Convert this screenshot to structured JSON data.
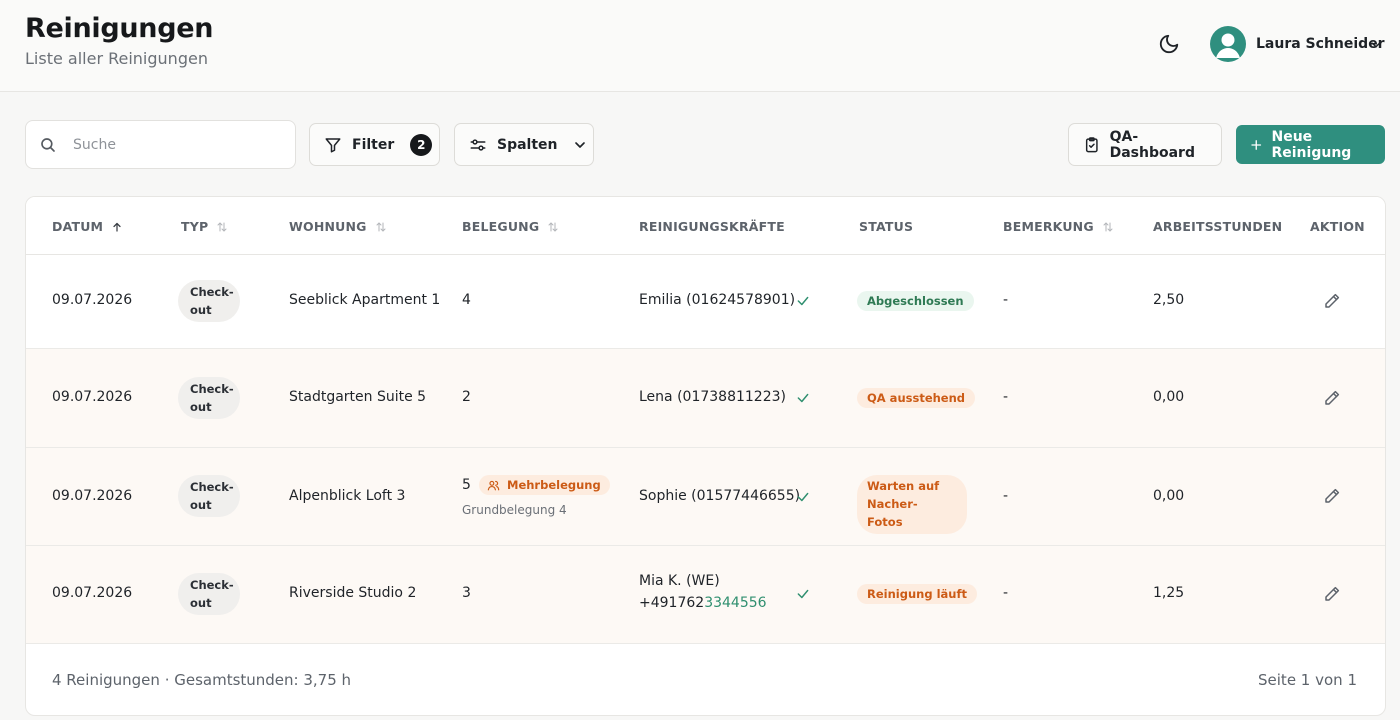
{
  "header": {
    "title": "Reinigungen",
    "subtitle": "Liste aller Reinigungen",
    "user_name": "Laura Schneider"
  },
  "toolbar": {
    "search_placeholder": "Suche",
    "filter_label": "Filter",
    "filter_count": "2",
    "columns_label": "Spalten",
    "qa_label": "QA-Dashboard",
    "new_label": "Neue Reinigung"
  },
  "table": {
    "columns": {
      "datum": "DATUM",
      "typ": "TYP",
      "wohnung": "WOHNUNG",
      "belegung": "BELEGUNG",
      "kraefte": "REINIGUNGSKRÄFTE",
      "status": "STATUS",
      "bemerkung": "BEMERKUNG",
      "stunden": "ARBEITSSTUNDEN",
      "aktion": "AKTION"
    },
    "rows": [
      {
        "date": "09.07.2026",
        "type_line1": "Check-",
        "type_line2": "out",
        "apartment": "Seeblick Apartment 1",
        "occupancy": "4",
        "cleaner": "Emilia (01624578901)",
        "status": "Abgeschlossen",
        "remark": "-",
        "hours": "2,50"
      },
      {
        "date": "09.07.2026",
        "type_line1": "Check-",
        "type_line2": "out",
        "apartment": "Stadtgarten Suite 5",
        "occupancy": "2",
        "cleaner": "Lena (01738811223)",
        "status": "QA ausstehend",
        "remark": "-",
        "hours": "0,00"
      },
      {
        "date": "09.07.2026",
        "type_line1": "Check-",
        "type_line2": "out",
        "apartment": "Alpenblick Loft 3",
        "occupancy": "5",
        "occupancy_badge": "Mehrbelegung",
        "occupancy_note": "Grundbelegung 4",
        "cleaner": "Sophie (01577446655)",
        "status_line1": "Warten auf",
        "status_line2": "Nacher-Fotos",
        "remark": "-",
        "hours": "0,00"
      },
      {
        "date": "09.07.2026",
        "type_line1": "Check-",
        "type_line2": "out",
        "apartment": "Riverside Studio 2",
        "occupancy": "3",
        "cleaner_line1": "Mia K. (WE)",
        "cleaner_phone_a": "+491762",
        "cleaner_phone_b": "3344556",
        "status": "Reinigung läuft",
        "remark": "-",
        "hours": "1,25"
      }
    ]
  },
  "footer": {
    "summary": "4 Reinigungen · Gesamtstunden: 3,75 h",
    "pagination": "Seite 1 von 1"
  },
  "colors": {
    "accent": "#2f8f7f",
    "status_done_bg": "#eaf6ef",
    "status_warn_bg": "#fdecdf",
    "status_warn_text": "#cc5b16"
  },
  "icons": [
    "moon-icon",
    "user-avatar-icon",
    "chevron-down-icon",
    "search-icon",
    "filter-icon",
    "sliders-icon",
    "clipboard-icon",
    "plus-icon",
    "sort-icon",
    "check-icon",
    "users-icon",
    "pencil-icon"
  ]
}
